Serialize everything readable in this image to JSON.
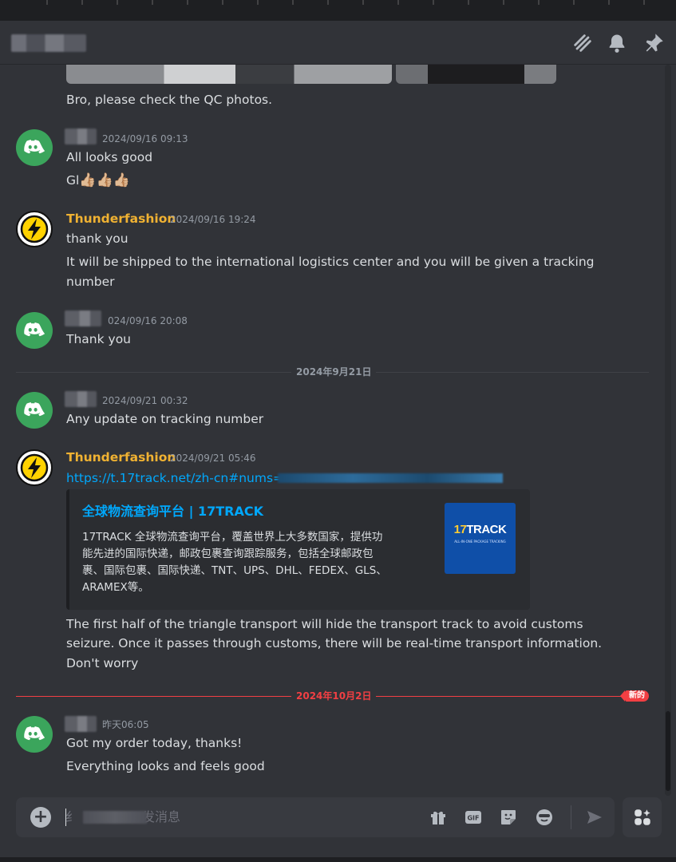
{
  "header": {
    "icons": [
      "threads-icon",
      "bell-icon",
      "pin-icon"
    ]
  },
  "messages": [
    {
      "id": "m0",
      "text": "Bro, please check the QC photos."
    },
    {
      "id": "m1",
      "timestamp": "2024/09/16 09:13",
      "lines": [
        "All looks good",
        "Gl"
      ],
      "emoji": "👍🏼👍🏼👍🏼"
    },
    {
      "id": "m2",
      "author": "Thunderfashion",
      "timestamp": "2024/09/16 19:24",
      "lines": [
        "thank you",
        "It will be shipped to the international logistics center and you will be given a tracking",
        "number"
      ]
    },
    {
      "id": "m3",
      "timestamp": "024/09/16 20:08",
      "lines": [
        "Thank you"
      ]
    },
    {
      "id": "m4",
      "timestamp": "2024/09/21 00:32",
      "lines": [
        "Any update on tracking number"
      ]
    },
    {
      "id": "m5",
      "author": "Thunderfashion",
      "timestamp": "2024/09/21 05:46",
      "link": "https://t.17track.net/zh-cn#nums=",
      "embed": {
        "title": "全球物流查询平台 | 17TRACK",
        "description_lines": [
          "17TRACK 全球物流查询平台，覆盖世界上大多数国家，提供功",
          "能先进的国际快递，邮政包裹查询跟踪服务，包括全球邮政包",
          "裹、国际包裹、国际快递、TNT、UPS、DHL、FEDEX、GLS、",
          "ARAMEX等。"
        ],
        "thumb_brand_prefix": "17",
        "thumb_brand_suffix": "TRACK",
        "thumb_tagline": "ALL-IN-ONE PACKAGE TRACKING"
      },
      "lines": [
        "The first half of the triangle transport will hide the transport track to avoid customs",
        "seizure. Once it passes through customs, there will be real-time transport information.",
        "Don't worry"
      ]
    },
    {
      "id": "m6",
      "timestamp": "昨天06:05",
      "lines": [
        "Got my order today, thanks!",
        "Everything looks and feels good"
      ]
    }
  ],
  "dividers": {
    "sep1": "2024年9月21日",
    "sep2": "2024年10月2日",
    "new_badge": "新的"
  },
  "composer": {
    "placeholder_visible_start": "纟",
    "placeholder_visible_end": "发消息",
    "icons": [
      "gift-icon",
      "gif-icon",
      "sticker-icon",
      "emoji-icon",
      "send-icon",
      "apps-icon"
    ],
    "gif_label": "GIF"
  },
  "colors": {
    "background": "#313338",
    "author_highlight": "#f0b232",
    "link": "#00a8fc",
    "new_divider": "#f23f43",
    "discord_avatar": "#3ba55c"
  }
}
